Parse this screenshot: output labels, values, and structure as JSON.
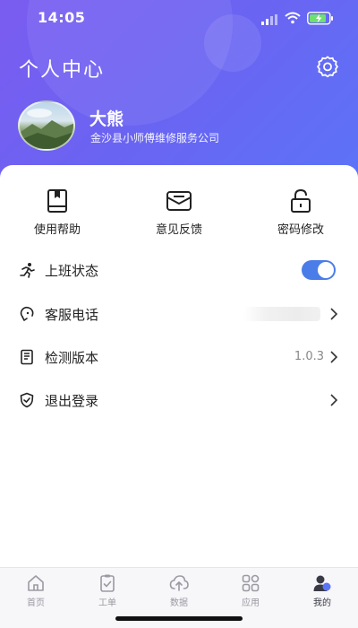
{
  "status_bar": {
    "time": "14:05"
  },
  "header": {
    "title": "个人中心",
    "user": {
      "name": "大熊",
      "company": "金沙县小师傅维修服务公司"
    }
  },
  "quick_actions": [
    {
      "label": "使用帮助",
      "icon": "book-icon"
    },
    {
      "label": "意见反馈",
      "icon": "mail-icon"
    },
    {
      "label": "密码修改",
      "icon": "lock-icon"
    }
  ],
  "menu": {
    "work_status": {
      "label": "上班状态",
      "enabled": true,
      "icon": "running-person-icon"
    },
    "service_phone": {
      "label": "客服电话",
      "icon": "phone-icon"
    },
    "check_version": {
      "label": "检测版本",
      "value": "1.0.3",
      "icon": "version-icon"
    },
    "logout": {
      "label": "退出登录",
      "icon": "shield-icon"
    }
  },
  "tabbar": {
    "items": [
      {
        "label": "首页",
        "icon": "home-icon"
      },
      {
        "label": "工单",
        "icon": "clipboard-icon"
      },
      {
        "label": "数据",
        "icon": "cloud-upload-icon"
      },
      {
        "label": "应用",
        "icon": "grid-icon"
      },
      {
        "label": "我的",
        "icon": "user-icon",
        "active": true
      }
    ]
  },
  "colors": {
    "header_start": "#7a5cf0",
    "header_end": "#5b74f7",
    "toggle_on": "#4a7de8"
  }
}
